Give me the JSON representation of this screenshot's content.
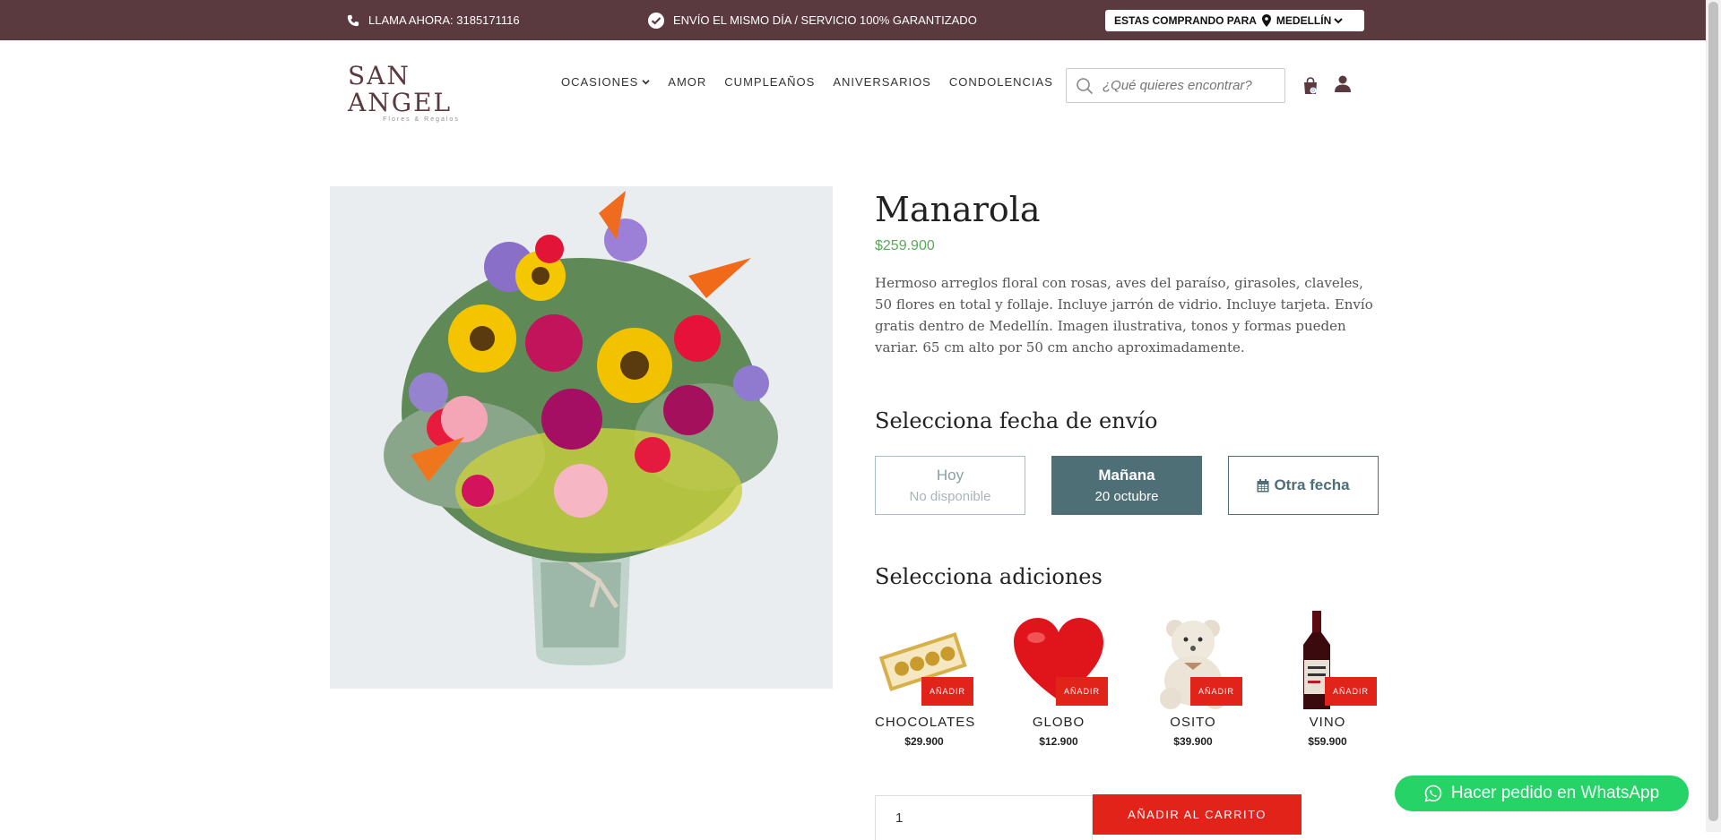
{
  "topbar": {
    "phone_text": "LLAMA AHORA: 3185171116",
    "shipping_text": "ENVÍO EL MISMO DÍA / SERVICIO 100% GARANTIZADO",
    "buying_for_label": "ESTAS COMPRANDO PARA",
    "city": "MEDELLÍN"
  },
  "header": {
    "logo_text": "SAN ANGEL",
    "logo_sub": "Flores & Regalos",
    "nav": [
      "OCASIONES",
      "AMOR",
      "CUMPLEAÑOS",
      "ANIVERSARIOS",
      "CONDOLENCIAS"
    ],
    "search_placeholder": "¿Qué quieres encontrar?",
    "cart_count": "0"
  },
  "product": {
    "title": "Manarola",
    "price": "$259.900",
    "description": "Hermoso arreglos floral con rosas, aves del paraíso, girasoles, claveles, 50 flores en total y follaje. Incluye jarrón de vidrio. Incluye tarjeta. Envío gratis dentro de Medellín. Imagen ilustrativa, tonos y formas pueden variar. 65 cm alto por 50 cm ancho aproximadamente."
  },
  "delivery": {
    "heading": "Selecciona fecha de envío",
    "options": [
      {
        "label": "Hoy",
        "sub": "No disponible"
      },
      {
        "label": "Mañana",
        "sub": "20 octubre"
      },
      {
        "label": "Otra fecha"
      }
    ]
  },
  "addons": {
    "heading": "Selecciona adiciones",
    "add_label": "AÑADIR",
    "items": [
      {
        "name": "CHOCOLATES",
        "price": "$29.900"
      },
      {
        "name": "GLOBO",
        "price": "$12.900"
      },
      {
        "name": "OSITO",
        "price": "$39.900"
      },
      {
        "name": "VINO",
        "price": "$59.900"
      }
    ]
  },
  "cart": {
    "quantity": "1",
    "add_to_cart": "AÑADIR AL CARRITO"
  },
  "whatsapp": {
    "label": "Hacer pedido en WhatsApp"
  },
  "colors": {
    "topbar": "#5b3a3f",
    "accent_teal": "#4e6f75",
    "price_green": "#5aa95a",
    "add_red": "#e2231a",
    "whatsapp_green": "#25d366"
  }
}
